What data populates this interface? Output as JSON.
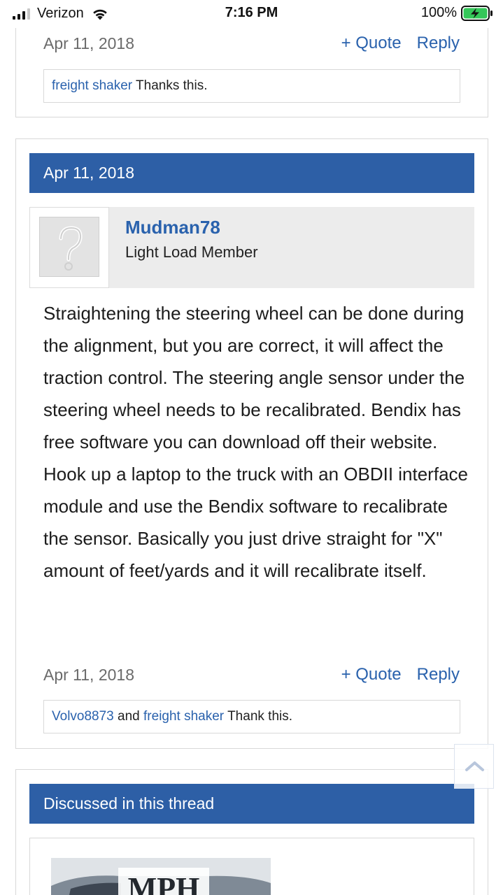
{
  "status_bar": {
    "carrier": "Verizon",
    "time": "7:16 PM",
    "battery_percent": "100%"
  },
  "prev_post": {
    "date": "Apr 11, 2018",
    "quote_label": "+ Quote",
    "reply_label": "Reply",
    "likes": {
      "user": "freight shaker",
      "suffix": " Thanks this."
    }
  },
  "post": {
    "header_date": "Apr 11, 2018",
    "author": {
      "name": "Mudman78",
      "title": "Light Load Member"
    },
    "body": "Straightening the steering wheel can be done during the alignment, but you are correct, it will affect the traction control. The steering angle sensor under the steering wheel needs to be recalibrated. Bendix has free software you can download off their website. Hook up a laptop to the truck with an OBDII interface module and use the Bendix software to recalibrate the sensor. Basically you just drive straight for \"X\" amount of feet/yards and it will recalibrate itself.",
    "footer_date": "Apr 11, 2018",
    "quote_label": "+ Quote",
    "reply_label": "Reply",
    "likes": {
      "user1": "Volvo8873",
      "connector": " and ",
      "user2": "freight shaker",
      "suffix": " Thank this."
    }
  },
  "discussed": {
    "header": "Discussed in this thread",
    "thumbnail_text": "MPH"
  },
  "icons": {
    "signal": "signal-bars-icon",
    "wifi": "wifi-icon",
    "battery": "battery-charging-icon",
    "avatar": "default-avatar-icon",
    "scroll": "chevron-up-icon"
  },
  "colors": {
    "accent_blue": "#2d5fa6",
    "link_blue": "#2a62ad",
    "battery_green": "#34c759"
  }
}
